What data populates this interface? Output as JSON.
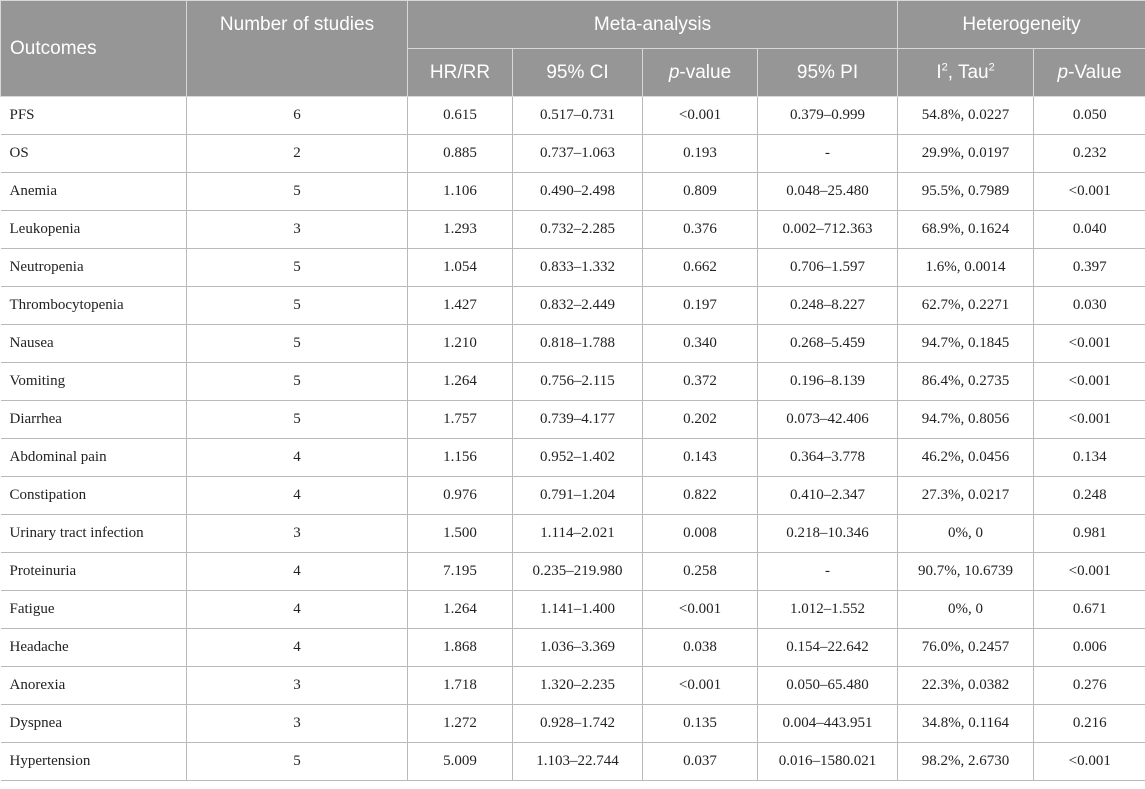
{
  "header": {
    "outcomes": "Outcomes",
    "number_of_studies": "Number of studies",
    "meta_analysis": "Meta-analysis",
    "heterogeneity": "Heterogeneity",
    "hr_rr": "HR/RR",
    "ci": "95% CI",
    "p_italic": "p",
    "p_value_suffix": "-value",
    "pi": "95% PI",
    "i_letter": "I",
    "i_sup": "2",
    "tau_text": ", Tau",
    "tau_sup": "2",
    "p_value_suffix_cap": "-Value"
  },
  "rows": [
    {
      "outcome": "PFS",
      "studies": "6",
      "hr_rr": "0.615",
      "ci": "0.517–0.731",
      "p": "<0.001",
      "pi": "0.379–0.999",
      "i2_tau2": "54.8%, 0.0227",
      "het_p": "0.050"
    },
    {
      "outcome": "OS",
      "studies": "2",
      "hr_rr": "0.885",
      "ci": "0.737–1.063",
      "p": "0.193",
      "pi": "-",
      "i2_tau2": "29.9%, 0.0197",
      "het_p": "0.232"
    },
    {
      "outcome": "Anemia",
      "studies": "5",
      "hr_rr": "1.106",
      "ci": "0.490–2.498",
      "p": "0.809",
      "pi": "0.048–25.480",
      "i2_tau2": "95.5%, 0.7989",
      "het_p": "<0.001"
    },
    {
      "outcome": "Leukopenia",
      "studies": "3",
      "hr_rr": "1.293",
      "ci": "0.732–2.285",
      "p": "0.376",
      "pi": "0.002–712.363",
      "i2_tau2": "68.9%, 0.1624",
      "het_p": "0.040"
    },
    {
      "outcome": "Neutropenia",
      "studies": "5",
      "hr_rr": "1.054",
      "ci": "0.833–1.332",
      "p": "0.662",
      "pi": "0.706–1.597",
      "i2_tau2": "1.6%, 0.0014",
      "het_p": "0.397"
    },
    {
      "outcome": "Thrombocytopenia",
      "studies": "5",
      "hr_rr": "1.427",
      "ci": "0.832–2.449",
      "p": "0.197",
      "pi": "0.248–8.227",
      "i2_tau2": "62.7%, 0.2271",
      "het_p": "0.030"
    },
    {
      "outcome": "Nausea",
      "studies": "5",
      "hr_rr": "1.210",
      "ci": "0.818–1.788",
      "p": "0.340",
      "pi": "0.268–5.459",
      "i2_tau2": "94.7%, 0.1845",
      "het_p": "<0.001"
    },
    {
      "outcome": "Vomiting",
      "studies": "5",
      "hr_rr": "1.264",
      "ci": "0.756–2.115",
      "p": "0.372",
      "pi": "0.196–8.139",
      "i2_tau2": "86.4%, 0.2735",
      "het_p": "<0.001"
    },
    {
      "outcome": "Diarrhea",
      "studies": "5",
      "hr_rr": "1.757",
      "ci": "0.739–4.177",
      "p": "0.202",
      "pi": "0.073–42.406",
      "i2_tau2": "94.7%, 0.8056",
      "het_p": "<0.001"
    },
    {
      "outcome": "Abdominal pain",
      "studies": "4",
      "hr_rr": "1.156",
      "ci": "0.952–1.402",
      "p": "0.143",
      "pi": "0.364–3.778",
      "i2_tau2": "46.2%, 0.0456",
      "het_p": "0.134"
    },
    {
      "outcome": "Constipation",
      "studies": "4",
      "hr_rr": "0.976",
      "ci": "0.791–1.204",
      "p": "0.822",
      "pi": "0.410–2.347",
      "i2_tau2": "27.3%, 0.0217",
      "het_p": "0.248"
    },
    {
      "outcome": "Urinary tract infection",
      "studies": "3",
      "hr_rr": "1.500",
      "ci": "1.114–2.021",
      "p": "0.008",
      "pi": "0.218–10.346",
      "i2_tau2": "0%, 0",
      "het_p": "0.981"
    },
    {
      "outcome": "Proteinuria",
      "studies": "4",
      "hr_rr": "7.195",
      "ci": "0.235–219.980",
      "p": "0.258",
      "pi": "-",
      "i2_tau2": "90.7%, 10.6739",
      "het_p": "<0.001"
    },
    {
      "outcome": "Fatigue",
      "studies": "4",
      "hr_rr": "1.264",
      "ci": "1.141–1.400",
      "p": "<0.001",
      "pi": "1.012–1.552",
      "i2_tau2": "0%, 0",
      "het_p": "0.671"
    },
    {
      "outcome": "Headache",
      "studies": "4",
      "hr_rr": "1.868",
      "ci": "1.036–3.369",
      "p": "0.038",
      "pi": "0.154–22.642",
      "i2_tau2": "76.0%, 0.2457",
      "het_p": "0.006"
    },
    {
      "outcome": "Anorexia",
      "studies": "3",
      "hr_rr": "1.718",
      "ci": "1.320–2.235",
      "p": "<0.001",
      "pi": "0.050–65.480",
      "i2_tau2": "22.3%, 0.0382",
      "het_p": "0.276"
    },
    {
      "outcome": "Dyspnea",
      "studies": "3",
      "hr_rr": "1.272",
      "ci": "0.928–1.742",
      "p": "0.135",
      "pi": "0.004–443.951",
      "i2_tau2": "34.8%, 0.1164",
      "het_p": "0.216"
    },
    {
      "outcome": "Hypertension",
      "studies": "5",
      "hr_rr": "5.009",
      "ci": "1.103–22.744",
      "p": "0.037",
      "pi": "0.016–1580.021",
      "i2_tau2": "98.2%, 2.6730",
      "het_p": "<0.001"
    }
  ]
}
